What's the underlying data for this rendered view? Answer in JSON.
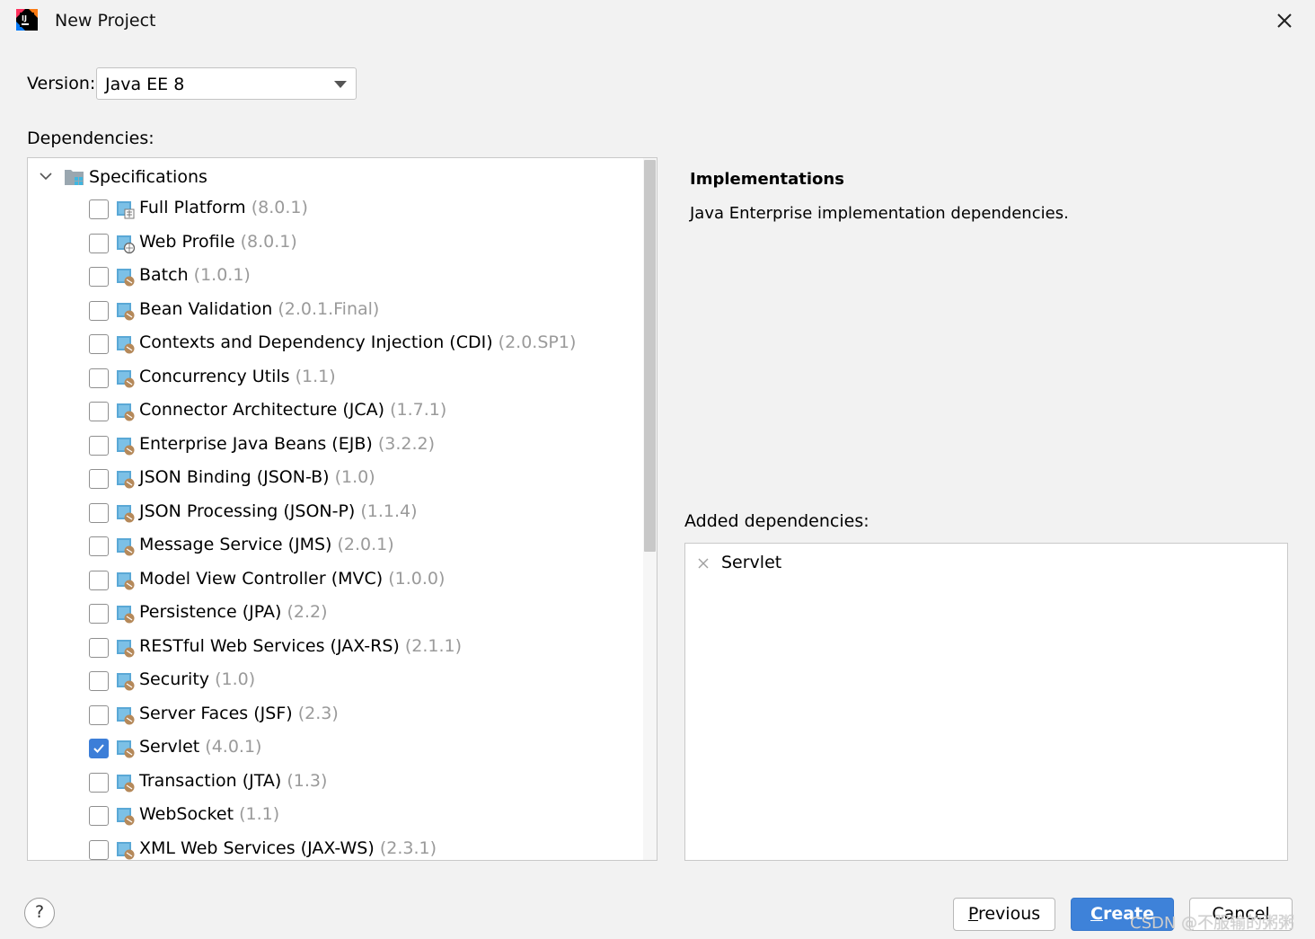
{
  "window": {
    "title": "New Project",
    "app_icon": "intellij-idea-icon",
    "close_icon": "close-icon"
  },
  "version": {
    "label": "Version:",
    "selected": "Java EE 8"
  },
  "dependencies": {
    "label": "Dependencies:",
    "root": {
      "label": "Specifications",
      "expanded": true
    },
    "items": [
      {
        "name": "Full Platform",
        "version": "(8.0.1)",
        "checked": false
      },
      {
        "name": "Web Profile",
        "version": "(8.0.1)",
        "checked": false
      },
      {
        "name": "Batch",
        "version": "(1.0.1)",
        "checked": false
      },
      {
        "name": "Bean Validation",
        "version": "(2.0.1.Final)",
        "checked": false
      },
      {
        "name": "Contexts and Dependency Injection (CDI)",
        "version": "(2.0.SP1)",
        "checked": false
      },
      {
        "name": "Concurrency Utils",
        "version": "(1.1)",
        "checked": false
      },
      {
        "name": "Connector Architecture (JCA)",
        "version": "(1.7.1)",
        "checked": false
      },
      {
        "name": "Enterprise Java Beans (EJB)",
        "version": "(3.2.2)",
        "checked": false
      },
      {
        "name": "JSON Binding (JSON-B)",
        "version": "(1.0)",
        "checked": false
      },
      {
        "name": "JSON Processing (JSON-P)",
        "version": "(1.1.4)",
        "checked": false
      },
      {
        "name": "Message Service (JMS)",
        "version": "(2.0.1)",
        "checked": false
      },
      {
        "name": "Model View Controller (MVC)",
        "version": "(1.0.0)",
        "checked": false
      },
      {
        "name": "Persistence (JPA)",
        "version": "(2.2)",
        "checked": false
      },
      {
        "name": "RESTful Web Services (JAX-RS)",
        "version": "(2.1.1)",
        "checked": false
      },
      {
        "name": "Security",
        "version": "(1.0)",
        "checked": false
      },
      {
        "name": "Server Faces (JSF)",
        "version": "(2.3)",
        "checked": false
      },
      {
        "name": "Servlet",
        "version": "(4.0.1)",
        "checked": true
      },
      {
        "name": "Transaction (JTA)",
        "version": "(1.3)",
        "checked": false
      },
      {
        "name": "WebSocket",
        "version": "(1.1)",
        "checked": false
      },
      {
        "name": "XML Web Services (JAX-WS)",
        "version": "(2.3.1)",
        "checked": false
      }
    ]
  },
  "details": {
    "title": "Implementations",
    "description": "Java Enterprise implementation dependencies."
  },
  "added": {
    "label": "Added dependencies:",
    "items": [
      "Servlet"
    ]
  },
  "footer": {
    "help": "?",
    "previous": {
      "mnemonic": "P",
      "rest": "revious"
    },
    "create": {
      "mnemonic": "C",
      "rest": "reate"
    },
    "cancel": "Cancel"
  },
  "watermark": "CSDN @不服输的粥粥",
  "colors": {
    "accent": "#3e82d9",
    "version_text": "#9a9a9a",
    "background": "#f2f2f2"
  }
}
